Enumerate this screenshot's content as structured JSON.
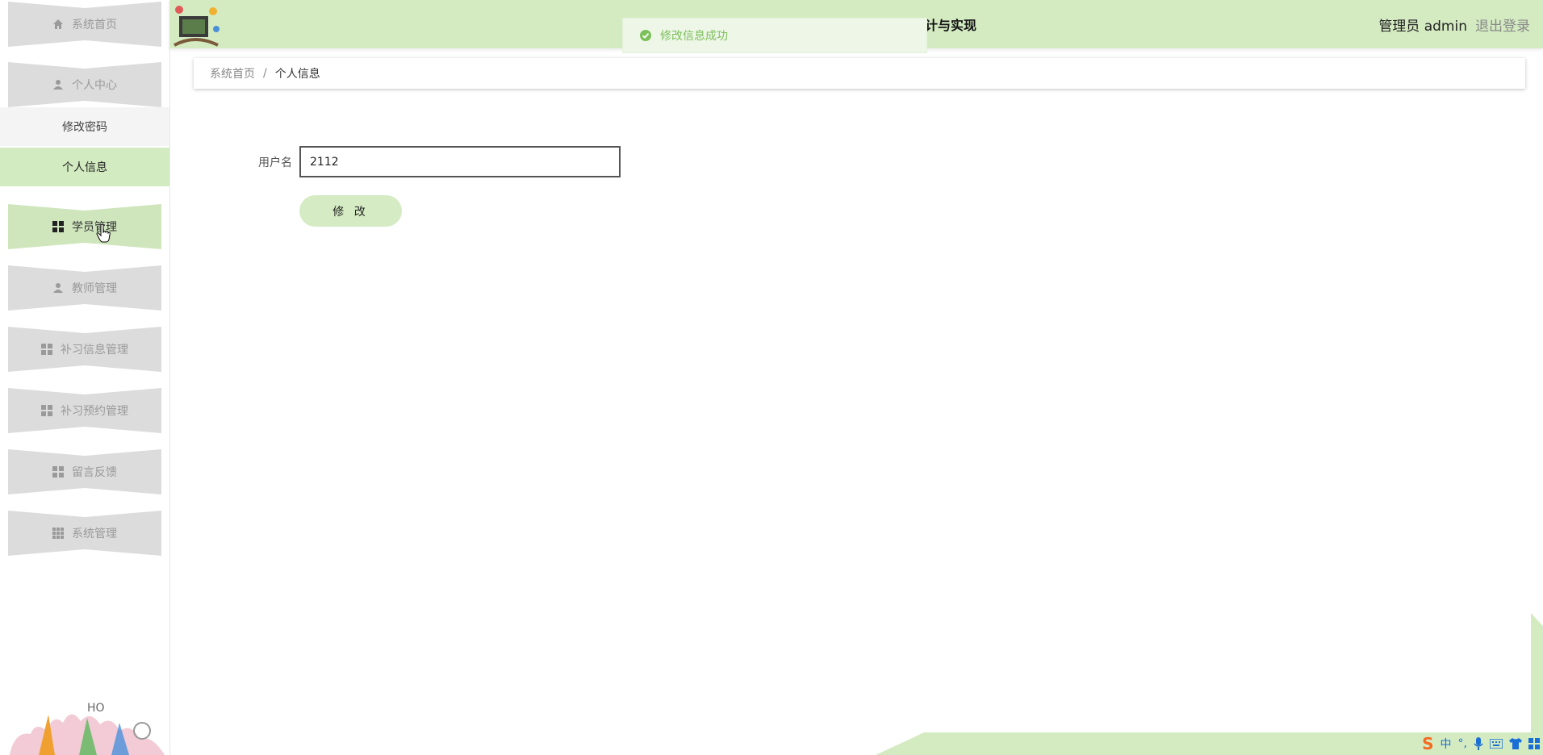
{
  "header": {
    "title_visible": "计与实现",
    "user_role": "管理员",
    "username": "admin",
    "logout_label": "退出登录"
  },
  "toast": {
    "message": "修改信息成功"
  },
  "sidebar": {
    "items": [
      {
        "label": "系统首页",
        "icon": "home-icon"
      },
      {
        "label": "个人中心",
        "icon": "user-icon"
      },
      {
        "label": "学员管理",
        "icon": "grid-icon"
      },
      {
        "label": "教师管理",
        "icon": "user-icon"
      },
      {
        "label": "补习信息管理",
        "icon": "grid-icon"
      },
      {
        "label": "补习预约管理",
        "icon": "grid-icon"
      },
      {
        "label": "留言反馈",
        "icon": "grid-icon"
      },
      {
        "label": "系统管理",
        "icon": "grid9-icon"
      }
    ],
    "sub_items": [
      {
        "label": "修改密码"
      },
      {
        "label": "个人信息"
      }
    ]
  },
  "breadcrumb": {
    "home": "系统首页",
    "separator": "/",
    "current": "个人信息"
  },
  "form": {
    "username_label": "用户名",
    "username_value": "2112",
    "submit_label": "修 改"
  },
  "ime": {
    "logo": "S",
    "lang": "中",
    "punct": "°,"
  },
  "colors": {
    "accent_green": "#d4ebc2",
    "toast_text": "#7cc05a",
    "menu_gray": "#dcdcdc"
  }
}
